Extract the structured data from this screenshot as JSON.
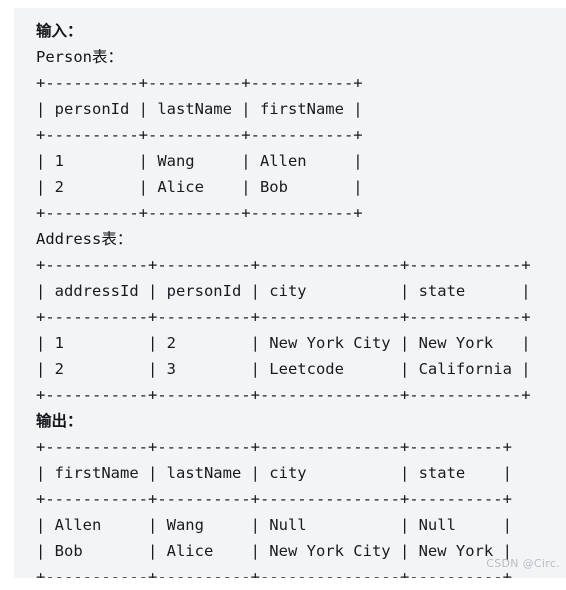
{
  "block": {
    "input_heading": "输入：",
    "output_heading": "输出：",
    "person_label": "Person表：",
    "address_label": "Address表：",
    "person_table": "+----------+----------+-----------+\n| personId | lastName | firstName |\n+----------+----------+-----------+\n| 1        | Wang     | Allen     |\n| 2        | Alice    | Bob       |\n+----------+----------+-----------+",
    "address_table": "+-----------+----------+---------------+------------+\n| addressId | personId | city          | state      |\n+-----------+----------+---------------+------------+\n| 1         | 2        | New York City | New York   |\n| 2         | 3        | Leetcode      | California |\n+-----------+----------+---------------+------------+",
    "output_table": "+-----------+----------+---------------+----------+\n| firstName | lastName | city          | state    |\n+-----------+----------+---------------+----------+\n| Allen     | Wang     | Null          | Null     |\n| Bob       | Alice    | New York City | New York |\n+-----------+----------+---------------+----------+"
  },
  "watermark": {
    "text": "CSDN @Circ."
  },
  "tables": {
    "person": {
      "name": "Person",
      "columns": [
        "personId",
        "lastName",
        "firstName"
      ],
      "rows": [
        [
          "1",
          "Wang",
          "Allen"
        ],
        [
          "2",
          "Alice",
          "Bob"
        ]
      ]
    },
    "address": {
      "name": "Address",
      "columns": [
        "addressId",
        "personId",
        "city",
        "state"
      ],
      "rows": [
        [
          "1",
          "2",
          "New York City",
          "New York"
        ],
        [
          "2",
          "3",
          "Leetcode",
          "California"
        ]
      ]
    },
    "output": {
      "columns": [
        "firstName",
        "lastName",
        "city",
        "state"
      ],
      "rows": [
        [
          "Allen",
          "Wang",
          "Null",
          "Null"
        ],
        [
          "Bob",
          "Alice",
          "New York City",
          "New York"
        ]
      ]
    }
  },
  "colors": {
    "block_background": "#f3f4f6",
    "page_background": "#ffffff",
    "text": "#1a1b20",
    "watermark": "#b9bcc2"
  }
}
